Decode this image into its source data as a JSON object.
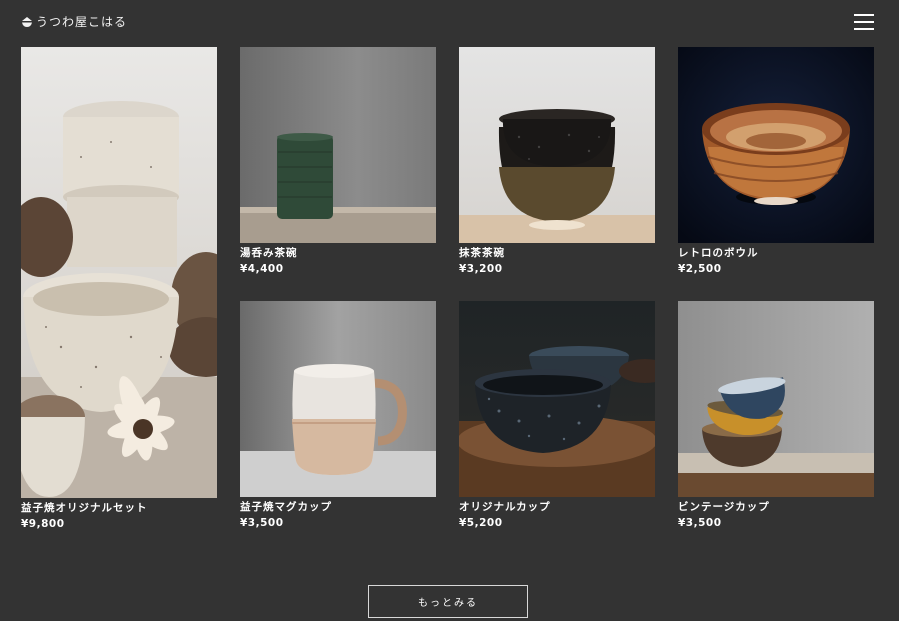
{
  "header": {
    "logo_text": "うつわ屋こはる",
    "logo_icon": "bowl-logo-icon",
    "menu_icon": "hamburger-menu-icon"
  },
  "products": [
    {
      "name": "湯呑み茶碗",
      "price": "¥4,400"
    },
    {
      "name": "抹茶茶碗",
      "price": "¥3,200"
    },
    {
      "name": "レトロのボウル",
      "price": "¥2,500"
    },
    {
      "name": "益子焼オリジナルセット",
      "price": "¥9,800"
    },
    {
      "name": "益子焼マグカップ",
      "price": "¥3,500"
    },
    {
      "name": "オリジナルカップ",
      "price": "¥5,200"
    },
    {
      "name": "ビンテージカップ",
      "price": "¥3,500"
    }
  ],
  "more_button": {
    "label": "もっとみる"
  },
  "colors": {
    "background": "#333333",
    "text": "#ffffff",
    "button_border": "#d8d8d8"
  }
}
